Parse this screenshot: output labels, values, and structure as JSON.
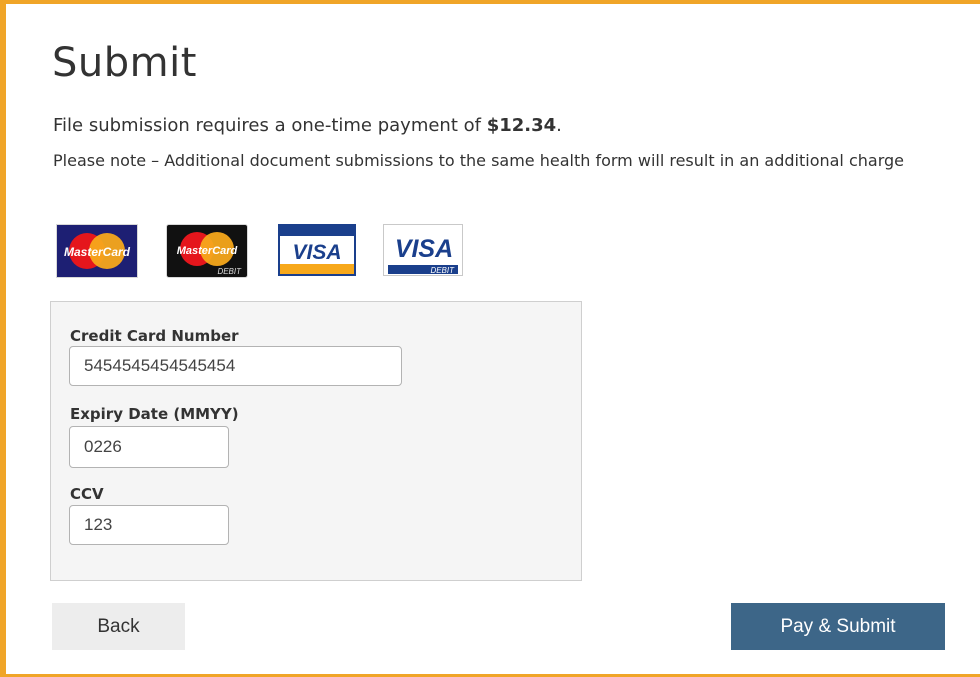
{
  "page": {
    "title": "Submit",
    "payment_text": "File submission requires a one-time payment of ",
    "amount": "$12.34",
    "period": ".",
    "note": "Please note – Additional document submissions to the same health form will result in an additional charge"
  },
  "cards": [
    {
      "icon": "mastercard-icon",
      "label": "MasterCard"
    },
    {
      "icon": "mastercard-debit-icon",
      "label": "MasterCard",
      "sub": "DEBIT"
    },
    {
      "icon": "visa-icon",
      "label": "VISA"
    },
    {
      "icon": "visa-debit-icon",
      "label": "VISA",
      "sub": "DEBIT"
    }
  ],
  "form": {
    "card_number_label": "Credit Card Number",
    "card_number_value": "5454545454545454",
    "expiry_label": "Expiry Date (MMYY)",
    "expiry_value": "0226",
    "ccv_label": "CCV",
    "ccv_value": "123"
  },
  "buttons": {
    "back": "Back",
    "pay": "Pay & Submit"
  },
  "colors": {
    "accent_border": "#f0a528",
    "primary_button": "#3d6688"
  }
}
